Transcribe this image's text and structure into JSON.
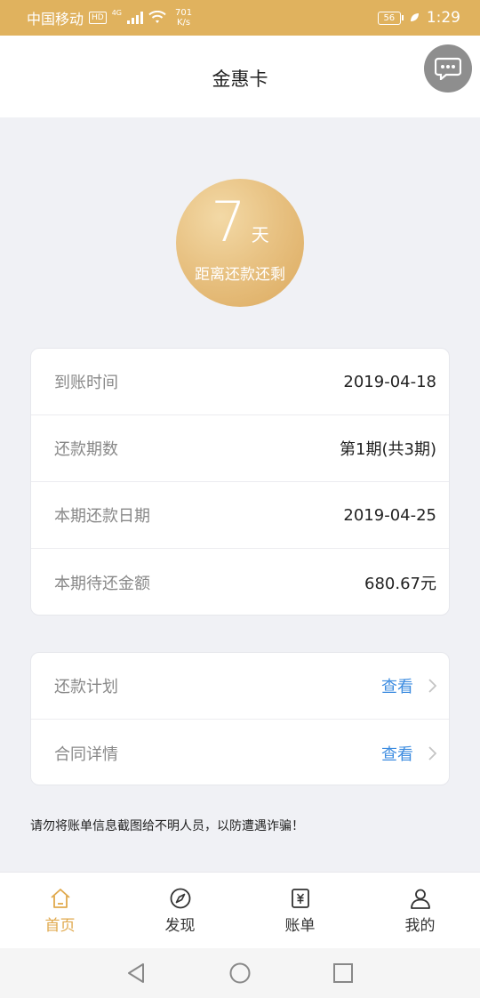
{
  "status_bar": {
    "carrier": "中国移动",
    "hd": "HD",
    "network": "4G",
    "speed_value": "701",
    "speed_unit": "K/s",
    "battery": "56",
    "time": "1:29"
  },
  "header": {
    "title": "金惠卡"
  },
  "countdown": {
    "number": "7",
    "unit": "天",
    "label": "距离还款还剩"
  },
  "repayment_info": [
    {
      "label": "到账时间",
      "value": "2019-04-18"
    },
    {
      "label": "还款期数",
      "value": "第1期(共3期)"
    },
    {
      "label": "本期还款日期",
      "value": "2019-04-25"
    },
    {
      "label": "本期待还金额",
      "value": "680.67元"
    }
  ],
  "links": [
    {
      "label": "还款计划",
      "action": "查看"
    },
    {
      "label": "合同详情",
      "action": "查看"
    }
  ],
  "warning": "请勿将账单信息截图给不明人员，以防遭遇诈骗！",
  "bottom_nav": [
    {
      "label": "首页",
      "icon": "home-icon",
      "active": true
    },
    {
      "label": "发现",
      "icon": "compass-icon",
      "active": false
    },
    {
      "label": "账单",
      "icon": "bill-icon",
      "active": false
    },
    {
      "label": "我的",
      "icon": "user-icon",
      "active": false
    }
  ],
  "colors": {
    "accent_gold": "#e0b25e",
    "link_blue": "#3d8ce0",
    "background": "#f0f1f5"
  }
}
